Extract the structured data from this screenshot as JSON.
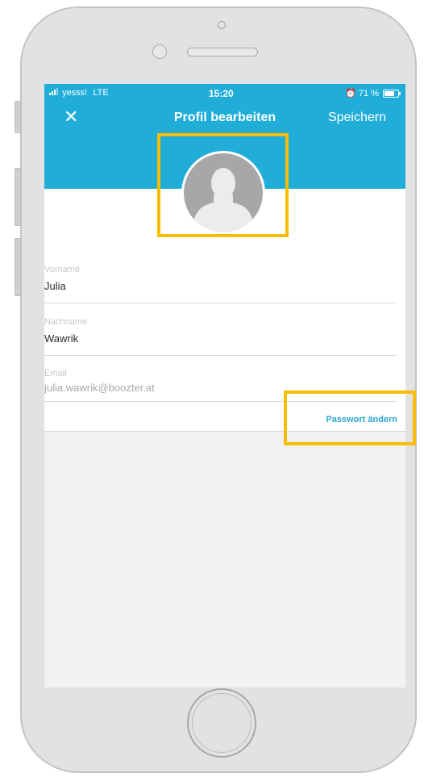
{
  "status_bar": {
    "carrier": "yesss!",
    "network": "LTE",
    "time": "15:20",
    "battery": "71 %"
  },
  "header": {
    "close_icon": "close-icon",
    "title": "Profil bearbeiten",
    "save_label": "Speichern"
  },
  "avatar": {
    "icon": "person-silhouette-icon"
  },
  "form": {
    "first_name": {
      "label": "Vorname",
      "value": "Julia"
    },
    "last_name": {
      "label": "Nachname",
      "value": "Wawrik"
    },
    "email": {
      "label": "Email",
      "value": "julia.wawrik@boozter.at"
    }
  },
  "password_link": "Passwort ändern",
  "colors": {
    "header": "#20aed9",
    "link": "#2aa9d2",
    "highlight": "#f8bd00"
  }
}
